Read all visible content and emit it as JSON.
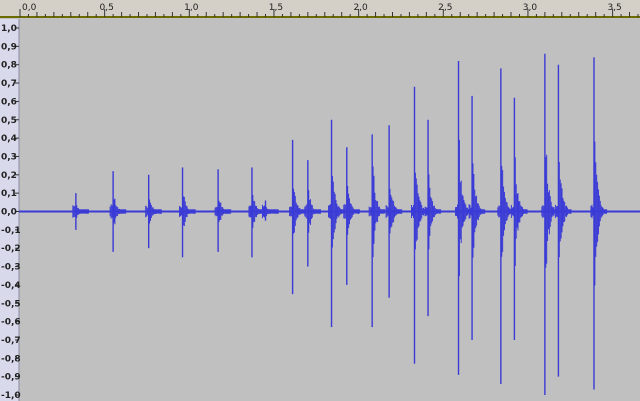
{
  "track": {
    "ruler_labels": [
      "0,0",
      "0,5",
      "1,0",
      "1,5",
      "2,0",
      "2,5",
      "3,0",
      "3,5"
    ],
    "amplitude_labels": [
      "1,0",
      "0,9",
      "0,8",
      "0,7",
      "0,6",
      "0,5",
      "0,4",
      "0,3",
      "0,2",
      "0,1",
      "0,0",
      "-0,1",
      "-0,2",
      "-0,3",
      "-0,4",
      "-0,5",
      "-0,6",
      "-0,7",
      "-0,8",
      "-0,9",
      "-1,0"
    ],
    "colors": {
      "background": "#c0c0c0",
      "ruler": "#d4d0c8",
      "scale_panel": "#d9d9ec",
      "waveform": "#3a3ad6",
      "baseline": "#3a3ad6",
      "ruler_accent": "#6b6b00"
    }
  },
  "chart_data": {
    "type": "area",
    "x_axis": {
      "label": "",
      "unit": "",
      "range": [
        0.0,
        3.65
      ],
      "ticks": [
        0.0,
        0.5,
        1.0,
        1.5,
        2.0,
        2.5,
        3.0,
        3.5
      ]
    },
    "y_axis": {
      "label": "",
      "range": [
        -1.0,
        1.0
      ],
      "ticks": [
        1.0,
        0.9,
        0.8,
        0.7,
        0.6,
        0.5,
        0.4,
        0.3,
        0.2,
        0.1,
        0.0,
        -0.1,
        -0.2,
        -0.3,
        -0.4,
        -0.5,
        -0.6,
        -0.7,
        -0.8,
        -0.9,
        -1.0
      ]
    },
    "series": [
      {
        "transients": [
          {
            "t": 0.33,
            "pos": 0.1,
            "neg": -0.1
          },
          {
            "t": 0.55,
            "pos": 0.22,
            "neg": -0.22
          },
          {
            "t": 0.76,
            "pos": 0.2,
            "neg": -0.2
          },
          {
            "t": 0.96,
            "pos": 0.24,
            "neg": -0.25
          },
          {
            "t": 1.17,
            "pos": 0.23,
            "neg": -0.22
          },
          {
            "t": 1.37,
            "pos": 0.24,
            "neg": -0.25
          },
          {
            "t": 1.45,
            "pos": 0.06,
            "neg": -0.05
          },
          {
            "t": 1.61,
            "pos": 0.39,
            "neg": -0.45
          },
          {
            "t": 1.7,
            "pos": 0.28,
            "neg": -0.3
          },
          {
            "t": 1.84,
            "pos": 0.5,
            "neg": -0.63
          },
          {
            "t": 1.93,
            "pos": 0.35,
            "neg": -0.4
          },
          {
            "t": 2.08,
            "pos": 0.42,
            "neg": -0.63
          },
          {
            "t": 2.18,
            "pos": 0.47,
            "neg": -0.47
          },
          {
            "t": 2.33,
            "pos": 0.68,
            "neg": -0.83
          },
          {
            "t": 2.41,
            "pos": 0.5,
            "neg": -0.57
          },
          {
            "t": 2.59,
            "pos": 0.82,
            "neg": -0.89
          },
          {
            "t": 2.67,
            "pos": 0.63,
            "neg": -0.7
          },
          {
            "t": 2.84,
            "pos": 0.78,
            "neg": -0.94
          },
          {
            "t": 2.92,
            "pos": 0.62,
            "neg": -0.7
          },
          {
            "t": 3.1,
            "pos": 0.86,
            "neg": -1.0
          },
          {
            "t": 3.18,
            "pos": 0.8,
            "neg": -0.9
          },
          {
            "t": 3.39,
            "pos": 0.84,
            "neg": -0.97
          }
        ],
        "noise_floor": 0.01
      }
    ],
    "grid": false
  }
}
